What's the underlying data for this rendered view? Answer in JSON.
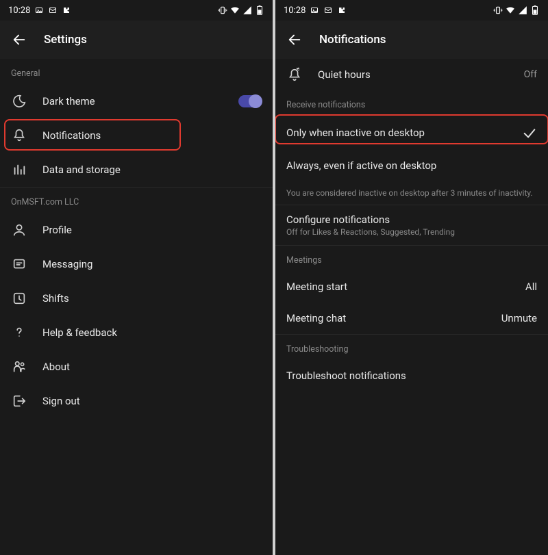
{
  "statusbar": {
    "time": "10:28",
    "icons": [
      "image-icon",
      "mms-icon",
      "puzzle-icon"
    ]
  },
  "left": {
    "title": "Settings",
    "sections": {
      "general": {
        "header": "General",
        "dark_theme": "Dark theme",
        "notifications": "Notifications",
        "data_storage": "Data and storage"
      },
      "org": {
        "header": "OnMSFT.com LLC",
        "profile": "Profile",
        "messaging": "Messaging",
        "shifts": "Shifts",
        "help": "Help & feedback",
        "about": "About",
        "signout": "Sign out"
      }
    }
  },
  "right": {
    "title": "Notifications",
    "quiet_hours": {
      "label": "Quiet hours",
      "value": "Off"
    },
    "receive_header": "Receive notifications",
    "option_inactive": "Only when inactive on desktop",
    "option_always": "Always, even if active on desktop",
    "inactive_note": "You are considered inactive on desktop after 3 minutes of inactivity.",
    "configure": {
      "title": "Configure notifications",
      "sub": "Off for Likes & Reactions, Suggested, Trending"
    },
    "meetings_header": "Meetings",
    "meeting_start": {
      "label": "Meeting start",
      "value": "All"
    },
    "meeting_chat": {
      "label": "Meeting chat",
      "value": "Unmute"
    },
    "troubleshooting_header": "Troubleshooting",
    "troubleshoot": "Troubleshoot notifications"
  }
}
